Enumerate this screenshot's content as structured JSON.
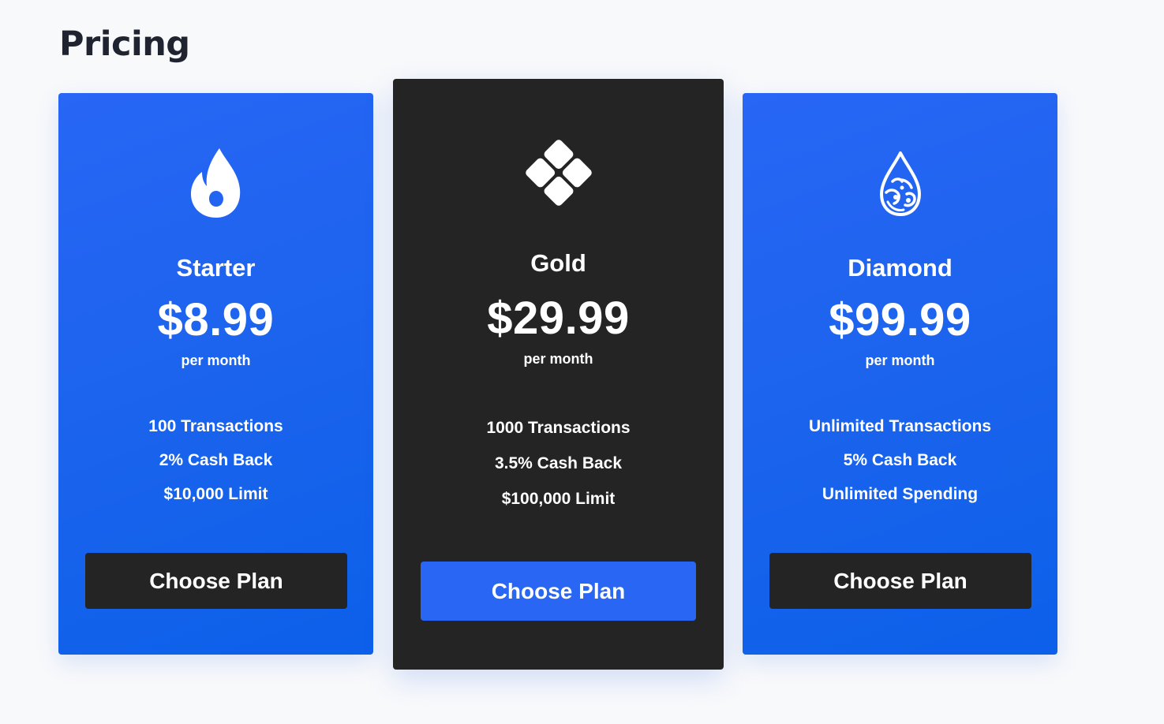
{
  "page": {
    "title": "Pricing"
  },
  "colors": {
    "accent_blue": "#2866f5",
    "dark_card": "#242424",
    "page_background": "#f8f9fb",
    "title_text": "#1f2430"
  },
  "plans": [
    {
      "icon": "flame-icon",
      "name": "Starter",
      "price": "$8.99",
      "period": "per month",
      "features": [
        "100 Transactions",
        "2% Cash Back",
        "$10,000 Limit"
      ],
      "button_label": "Choose Plan"
    },
    {
      "icon": "diamond-grid-icon",
      "name": "Gold",
      "price": "$29.99",
      "period": "per month",
      "features": [
        "1000 Transactions",
        "3.5% Cash Back",
        "$100,000 Limit"
      ],
      "button_label": "Choose Plan"
    },
    {
      "icon": "water-drop-icon",
      "name": "Diamond",
      "price": "$99.99",
      "period": "per month",
      "features": [
        "Unlimited Transactions",
        "5% Cash Back",
        "Unlimited Spending"
      ],
      "button_label": "Choose Plan"
    }
  ]
}
